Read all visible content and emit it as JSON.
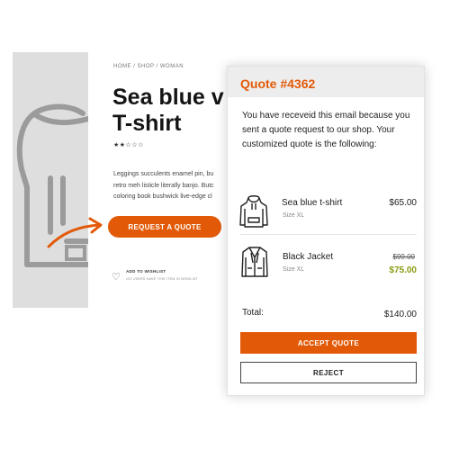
{
  "product": {
    "breadcrumb": "HOME / SHOP / WOMAN",
    "title_line1": "Sea blue v",
    "title_line2": "T-shirt",
    "rating_stars": "★★☆☆☆",
    "description_lines": [
      "Leggings succulents enamel pin, bu",
      "retro meh listicle literally banjo. Butc",
      "coloring book bushwick live-edge cl"
    ],
    "request_quote_label": "REQUEST A QUOTE",
    "wishlist_label": "ADD TO WISHLIST",
    "wishlist_sub": "120 USERS HAVE THIS ITEM IN WISHLIST"
  },
  "quote": {
    "title": "Quote #4362",
    "message": "You have receveid this email because you sent a quote request to our shop. Your customized quote is the following:",
    "items": [
      {
        "name": "Sea blue t-shirt",
        "size": "Size XL",
        "price": "$65.00",
        "icon": "hoodie-icon"
      },
      {
        "name": "Black Jacket",
        "size": "Size XL",
        "old_price": "$99.00",
        "new_price": "$75.00",
        "icon": "jacket-icon"
      }
    ],
    "total_label": "Total:",
    "total_value": "$140.00",
    "accept_label": "ACCEPT QUOTE",
    "reject_label": "REJECT"
  },
  "colors": {
    "accent": "#e25a08",
    "sale_price": "#8a9a10",
    "image_bg": "#dedede"
  }
}
